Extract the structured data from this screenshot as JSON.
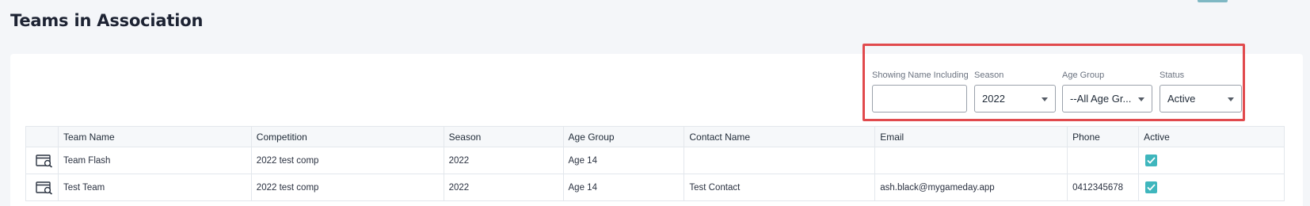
{
  "page": {
    "title": "Teams in Association"
  },
  "filters": {
    "name": {
      "label": "Showing Name Including",
      "value": ""
    },
    "season": {
      "label": "Season",
      "value": "2022"
    },
    "age_group": {
      "label": "Age Group",
      "value": "--All Age Gr..."
    },
    "status": {
      "label": "Status",
      "value": "Active"
    }
  },
  "table": {
    "columns": [
      "",
      "Team Name",
      "Competition",
      "Season",
      "Age Group",
      "Contact Name",
      "Email",
      "Phone",
      "Active"
    ],
    "rows": [
      {
        "team": "Team Flash",
        "competition": "2022 test comp",
        "season": "2022",
        "age_group": "Age 14",
        "contact": "",
        "email": "",
        "phone": "",
        "active": true
      },
      {
        "team": "Test Team",
        "competition": "2022 test comp",
        "season": "2022",
        "age_group": "Age 14",
        "contact": "Test Contact",
        "email": "ash.black@mygameday.app",
        "phone": "0412345678",
        "active": true
      }
    ]
  },
  "icons": {
    "view": "view-details-icon",
    "active": "checkbox-checked-icon"
  },
  "colors": {
    "accent": "#3fb6bd",
    "highlight": "#e14a4d"
  }
}
